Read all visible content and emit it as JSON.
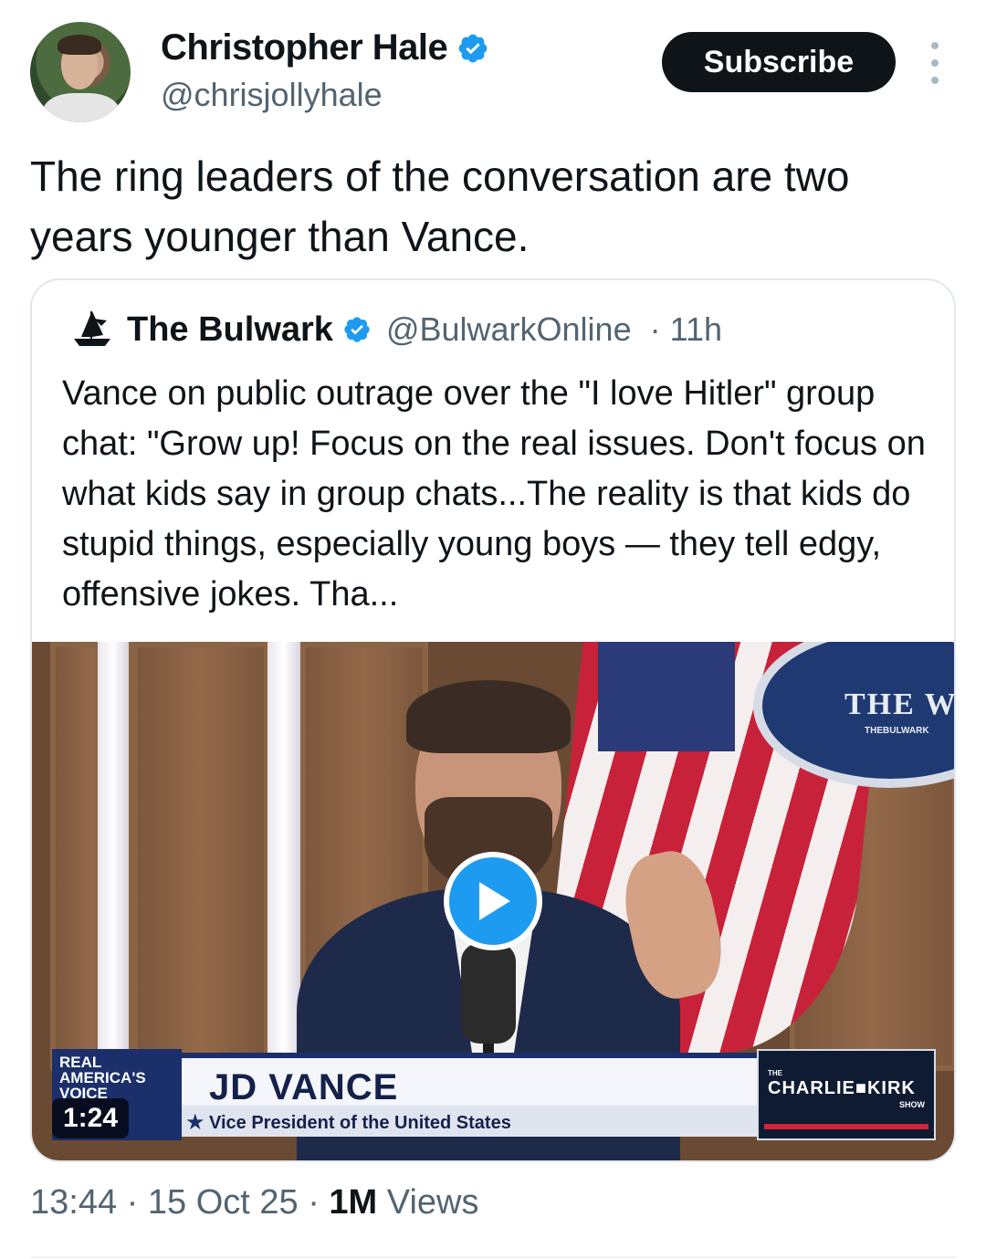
{
  "author": {
    "name": "Christopher Hale",
    "handle": "@chrisjollyhale",
    "verified": true
  },
  "actions": {
    "subscribe_label": "Subscribe",
    "more_icon": "more-vertical-icon"
  },
  "tweet": {
    "text": "The ring leaders of the conversation are two years younger than Vance."
  },
  "quoted": {
    "name": "The Bulwark",
    "handle": "@BulwarkOnline",
    "time": "· 11h",
    "text": "Vance on public outrage over the \"I love Hitler\" group chat: \"Grow up! Focus on the real issues. Don't focus on what kids say in group chats...The reality is that kids do stupid things, especially young boys — they tell edgy, offensive jokes. Tha...",
    "video": {
      "duration": "1:24",
      "lower_third_name": "JD VANCE",
      "lower_third_title": "Vice President of the United States",
      "network_logo": "REAL AMERICA'S VOICE",
      "show_the": "THE",
      "show_name": "CHARLIE■KIRK",
      "show_sub": "SHOW",
      "backdrop_text": "THE W",
      "backdrop_sub": "THEBULWARK"
    }
  },
  "meta": {
    "time": "13:44",
    "date": "15 Oct 25",
    "views_count": "1M",
    "views_label": "Views"
  },
  "colors": {
    "accent": "#1d9bf0",
    "text": "#0f1419",
    "muted": "#536471"
  }
}
